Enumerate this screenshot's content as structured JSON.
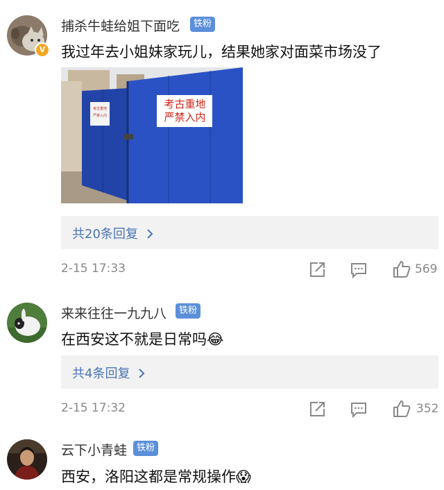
{
  "comments": [
    {
      "username": "捕杀牛蛙给姐下面吃",
      "badge": "铁粉",
      "verified": true,
      "text": "我过年去小姐妹家玩儿，结果她家对面菜市场没了",
      "photo_signs": {
        "big": [
          "考古重地",
          "严禁入内"
        ],
        "small": [
          "考古重地",
          "严禁入内"
        ]
      },
      "reply_link": "共20条回复",
      "time": "2-15 17:33",
      "likes": "569"
    },
    {
      "username": "来来往往一九九八",
      "badge": "铁粉",
      "text": "在西安这不就是日常吗😂",
      "reply_link": "共4条回复",
      "time": "2-15 17:32",
      "likes": "352"
    },
    {
      "username": "云下小青蛙",
      "badge": "铁粉",
      "text": "西安，洛阳这都是常规操作😱"
    }
  ],
  "colors": {
    "link": "#4a74b4",
    "badge": "#5b8fd9",
    "meta": "#888888",
    "reply_bg": "#f2f2f2",
    "verified": "#f5a623"
  }
}
